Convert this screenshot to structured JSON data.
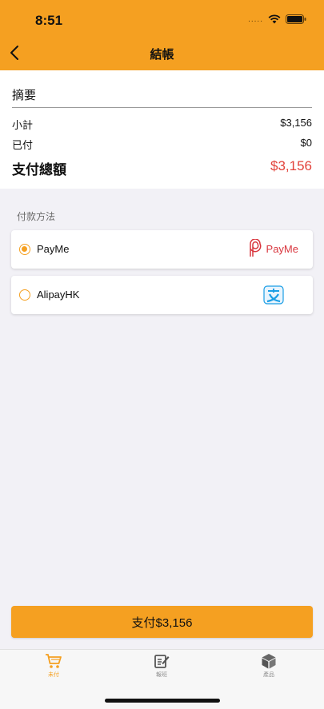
{
  "status_bar": {
    "time": "8:51",
    "dots": "....."
  },
  "nav": {
    "title": "結帳"
  },
  "summary": {
    "title": "摘要",
    "subtotal_label": "小計",
    "subtotal_value": "$3,156",
    "paid_label": "已付",
    "paid_value": "$0",
    "total_label": "支付總額",
    "total_value": "$3,156"
  },
  "payment": {
    "section_label": "付款方法",
    "methods": [
      {
        "name": "PayMe",
        "logo_text": "PayMe",
        "selected": true
      },
      {
        "name": "AlipayHK",
        "selected": false
      }
    ]
  },
  "pay_button": {
    "label": "支付$3,156"
  },
  "tabbar": {
    "tabs": [
      {
        "label": "未付",
        "icon": "cart-icon",
        "active": true
      },
      {
        "label": "報班",
        "icon": "edit-document-icon",
        "active": false
      },
      {
        "label": "產品",
        "icon": "box-icon",
        "active": false
      }
    ]
  },
  "colors": {
    "accent": "#f5a021",
    "total_red": "#e2423a",
    "background": "#f2f1f6"
  }
}
